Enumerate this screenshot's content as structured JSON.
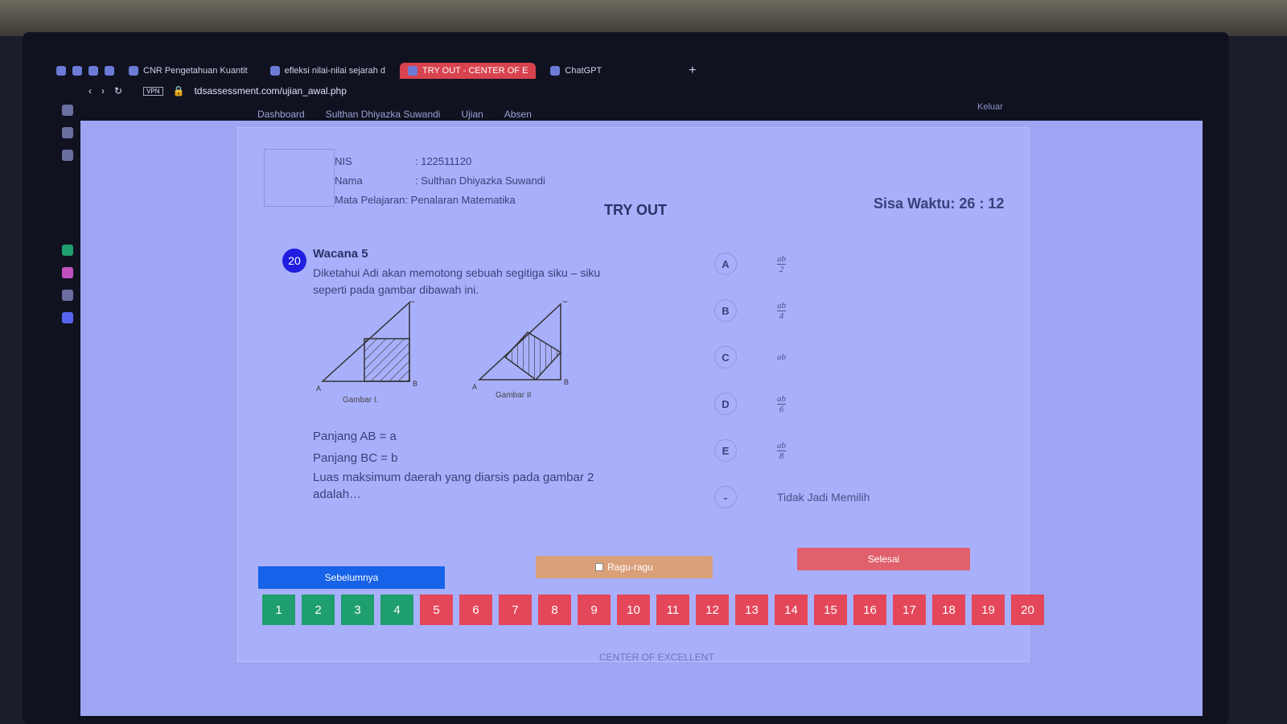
{
  "browser": {
    "tabs": [
      {
        "label": "CNR Pengetahuan Kuantit"
      },
      {
        "label": "efleksi nilai-nilai sejarah d"
      },
      {
        "label": "TRY OUT - CENTER OF E",
        "active": true
      },
      {
        "label": "ChatGPT"
      }
    ],
    "new_tab": "+",
    "url": "tdsassessment.com/ujian_awal.php",
    "vpn": "VPN"
  },
  "nav": {
    "items": [
      "Dashboard",
      "Sulthan Dhiyazka Suwandi",
      "Ujian",
      "Absen"
    ],
    "logout": "Keluar"
  },
  "student": {
    "nis_label": "NIS",
    "nis": ": 122511120",
    "name_label": "Nama",
    "name": ": Sulthan Dhiyazka Suwandi",
    "subject_label": "Mata Pelajaran",
    "subject": ": Penalaran Matematika"
  },
  "title": "TRY OUT",
  "timer": "Sisa Waktu: 26 : 12",
  "question": {
    "number": "20",
    "heading": "Wacana 5",
    "text": "Diketahui Adi akan memotong sebuah segitiga siku – siku seperti pada gambar dibawah ini.",
    "fig1_caption": "Gambar I.",
    "fig2_caption": "Gambar II",
    "line1": "Panjang AB = a",
    "line2": "Panjang BC = b",
    "prompt": "Luas maksimum daerah yang diarsis pada gambar 2 adalah…"
  },
  "options": [
    {
      "letter": "A",
      "num": "ab",
      "den": "2"
    },
    {
      "letter": "B",
      "num": "ab",
      "den": "4"
    },
    {
      "letter": "C",
      "value": "ab"
    },
    {
      "letter": "D",
      "num": "ab",
      "den": "6"
    },
    {
      "letter": "E",
      "num": "ab",
      "den": "8"
    },
    {
      "letter": "-",
      "value": "Tidak Jadi Memilih"
    }
  ],
  "buttons": {
    "prev": "Sebelumnya",
    "doubt": "Ragu-ragu",
    "finish": "Selesai"
  },
  "question_nav": {
    "answered": [
      "1",
      "2",
      "3",
      "4"
    ],
    "unanswered": [
      "5",
      "6",
      "7",
      "8",
      "9",
      "10",
      "11",
      "12",
      "13",
      "14",
      "15",
      "16",
      "17",
      "18",
      "19",
      "20"
    ]
  },
  "colors": {
    "answered": "#1f9e6e",
    "unanswered": "#e4475a",
    "prev": "#1662e8",
    "active_tab": "#d8434f"
  },
  "footer": "CENTER OF EXCELLENT"
}
